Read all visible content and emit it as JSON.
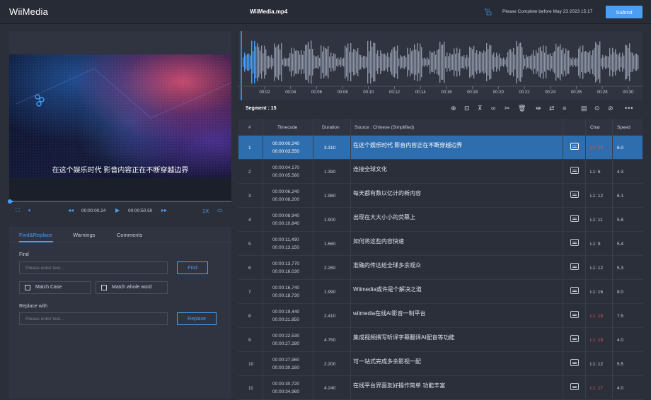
{
  "app": {
    "logo": "WiiMedia",
    "file_name": "WiiMedia.mp4",
    "deadline": "Please Complete before May 23 2023 15:17",
    "submit_label": "Submit",
    "lang_icon": "En/translate-icon"
  },
  "video": {
    "subtitle": "在这个娱乐时代 影音内容正在不断穿越边界",
    "current_time": "00:00:00.24",
    "total_time": "00:00:50.50",
    "speed": "1X",
    "progress": 0.005
  },
  "find_panel": {
    "tabs": [
      "Find&Replace",
      "Warnings",
      "Comments"
    ],
    "find_label": "Find",
    "find_placeholder": "Please enter text...",
    "find_button": "Find",
    "match_case": "Match Case",
    "match_whole_word": "Match whole word",
    "replace_label": "Replace with",
    "replace_placeholder": "Please enter text...",
    "replace_button": "Replace"
  },
  "waveform": {
    "ticks": [
      "00:02",
      "00:04",
      "00:06",
      "00:08",
      "00:10",
      "00:12",
      "00:14",
      "00:16",
      "00:18",
      "00:20",
      "00:22",
      "00:24",
      "00:26",
      "00:28",
      "00:30"
    ]
  },
  "segments": {
    "label": "Segment : 15"
  },
  "table": {
    "headers": {
      "num": "#",
      "timecode": "Timecode",
      "duration": "Duration",
      "source": "Source : Chinese (Simplified)",
      "char": "Char",
      "speed": "Speed"
    },
    "rows": [
      {
        "num": "1",
        "start": "00:00:00,240",
        "end": "00:00:03,550",
        "duration": "3.310",
        "text": "在这个娱乐时代 影音内容正在不断穿越边界",
        "char": "L1: 20",
        "warn": true,
        "speed": "6.0"
      },
      {
        "num": "2",
        "start": "00:00:04,170",
        "end": "00:00:05,560",
        "duration": "1.390",
        "text": "连接全球文化",
        "char": "L1: 6",
        "warn": false,
        "speed": "4.3"
      },
      {
        "num": "3",
        "start": "00:00:06,240",
        "end": "00:00:08,200",
        "duration": "1.960",
        "text": "每天都有数以亿计的新内容",
        "char": "L1: 12",
        "warn": false,
        "speed": "6.1"
      },
      {
        "num": "4",
        "start": "00:00:08,940",
        "end": "00:00:10,840",
        "duration": "1.900",
        "text": "出现在大大小小的荧幕上",
        "char": "L1: 11",
        "warn": false,
        "speed": "5.8"
      },
      {
        "num": "5",
        "start": "00:00:11,490",
        "end": "00:00:13,150",
        "duration": "1.660",
        "text": "如何将这些内容快速",
        "char": "L1: 9",
        "warn": false,
        "speed": "5.4"
      },
      {
        "num": "6",
        "start": "00:00:13,770",
        "end": "00:00:16,030",
        "duration": "2.260",
        "text": "准确的传达给全球多余观众",
        "char": "L1: 12",
        "warn": false,
        "speed": "5.3"
      },
      {
        "num": "7",
        "start": "00:00:16,740",
        "end": "00:00:18,730",
        "duration": "1.990",
        "text": "Wiimedia或许是个解决之道",
        "char": "L1: 16",
        "warn": false,
        "speed": "8.0"
      },
      {
        "num": "8",
        "start": "00:00:19,440",
        "end": "00:00:21,850",
        "duration": "2.410",
        "text": "wiimedia在线AI影音一制平台",
        "char": "L1: 18",
        "warn": true,
        "speed": "7.5"
      },
      {
        "num": "9",
        "start": "00:00:22,530",
        "end": "00:00:27,280",
        "duration": "4.750",
        "text": "集成视频撰写听译字幕翻译AI配音等功能",
        "char": "L1: 19",
        "warn": true,
        "speed": "4.0"
      },
      {
        "num": "10",
        "start": "00:00:27,960",
        "end": "00:00:30,160",
        "duration": "2.200",
        "text": "可一站式完成多余影视一配",
        "char": "L1: 12",
        "warn": false,
        "speed": "5.5"
      },
      {
        "num": "11",
        "start": "00:00:30,720",
        "end": "00:00:34,960",
        "duration": "4.240",
        "text": "在线平台界面友好操作简单 功能丰富",
        "char": "L1: 17",
        "warn": true,
        "speed": "4.0"
      }
    ]
  },
  "colors": {
    "accent": "#4a9ff5",
    "selected_row": "#2f6eae",
    "warn": "#e0514a",
    "bg": "#2b2f3a"
  }
}
